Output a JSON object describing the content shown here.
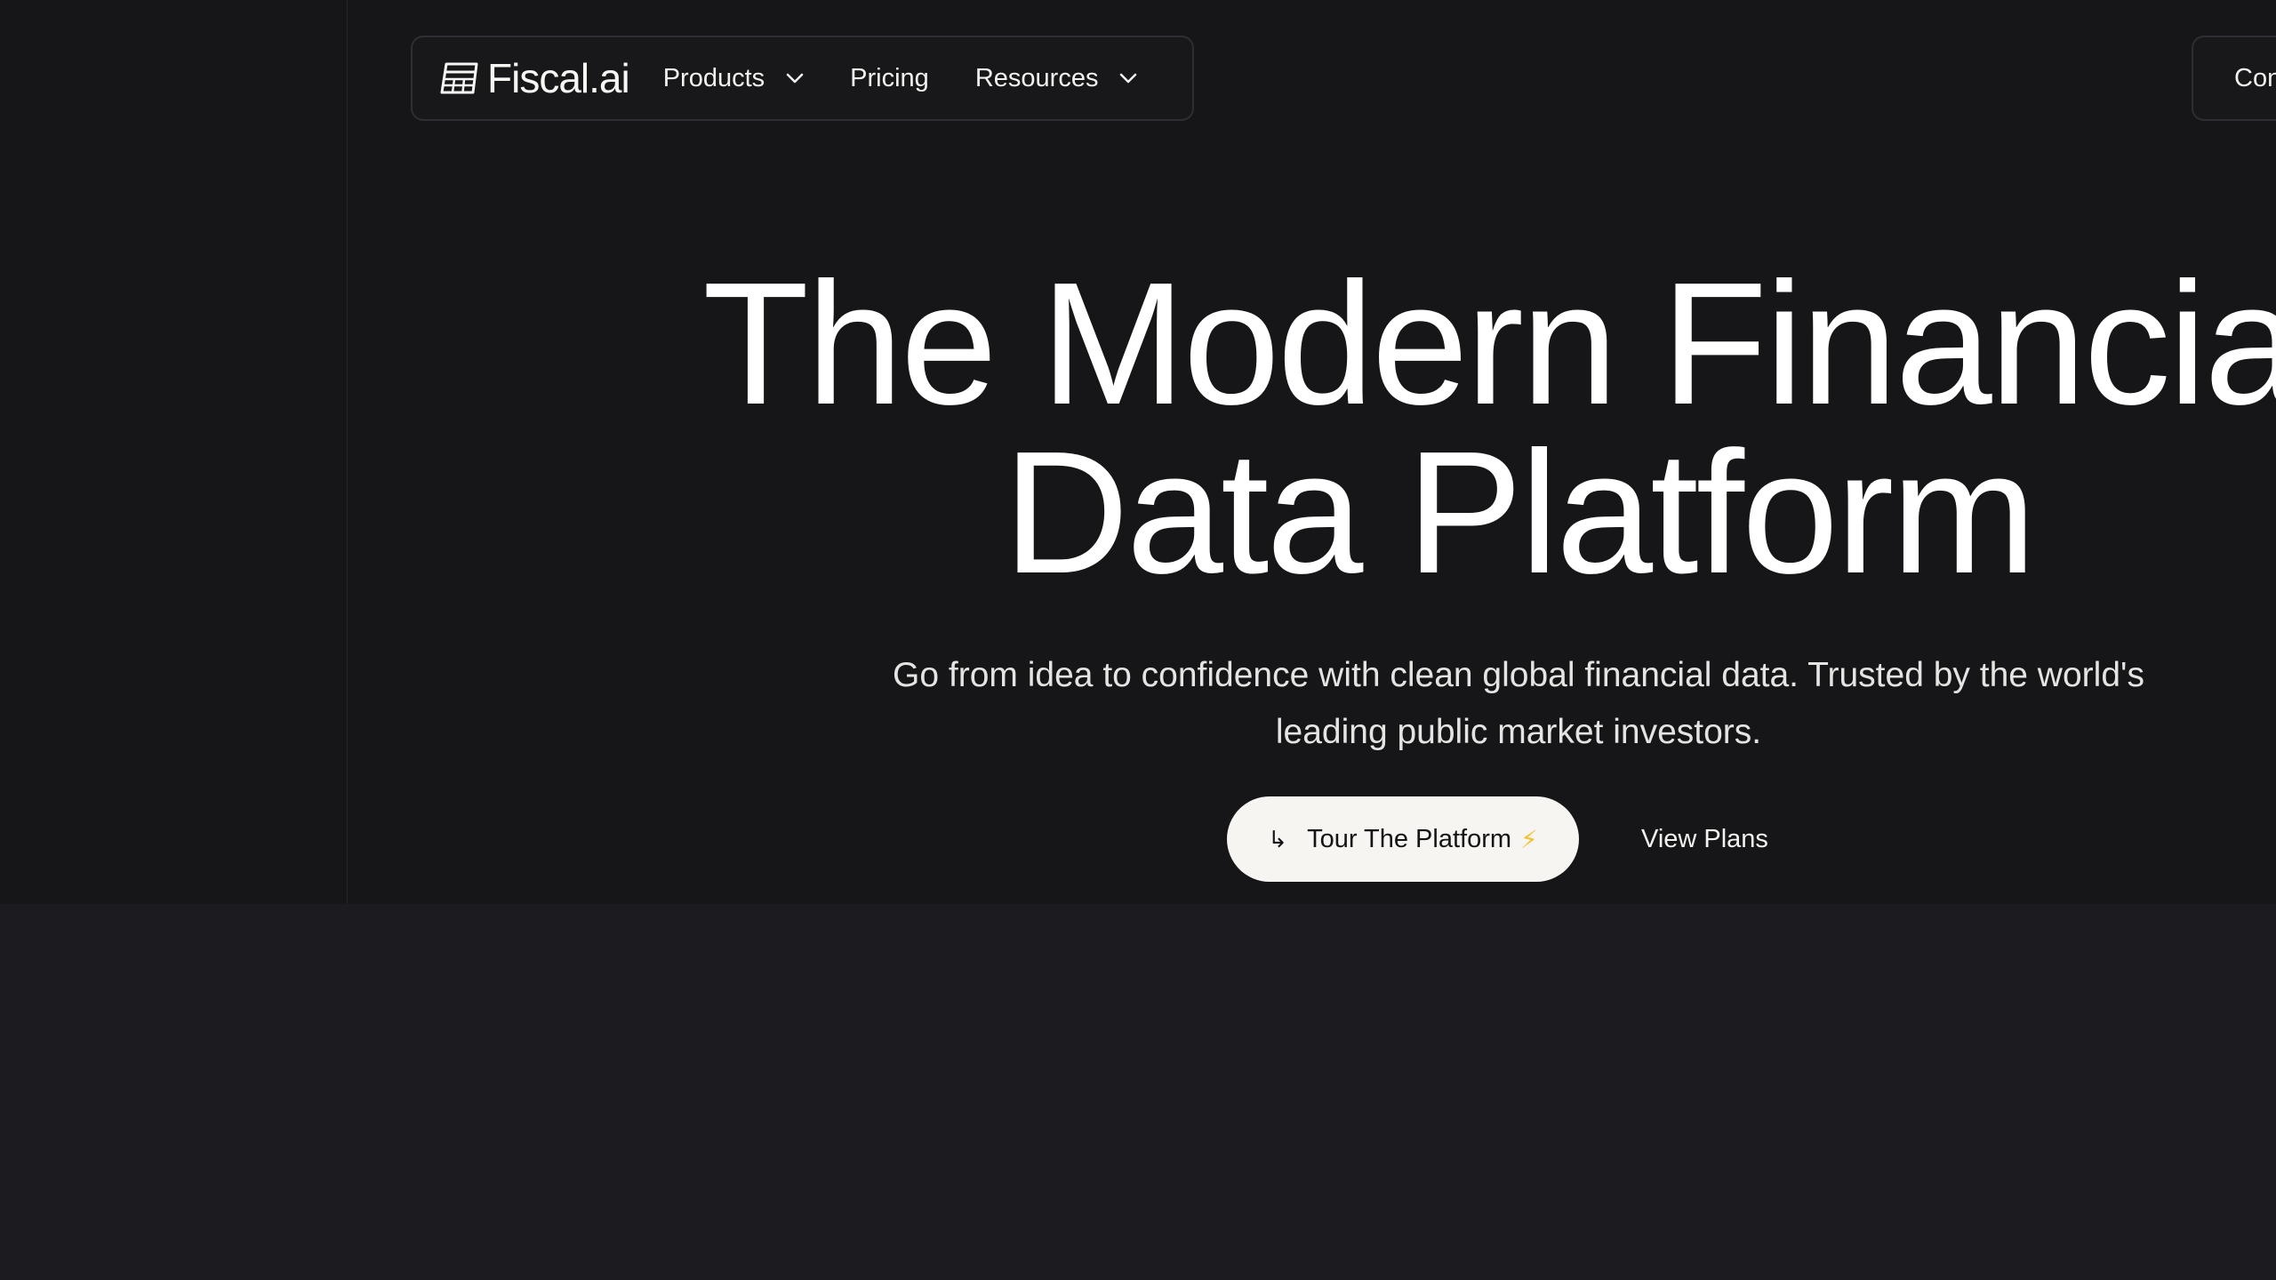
{
  "nav": {
    "brand": "Fiscal.ai",
    "logo_icon": "ledger-grid-icon",
    "items": [
      {
        "label": "Products",
        "has_dropdown": true
      },
      {
        "label": "Pricing",
        "has_dropdown": false
      },
      {
        "label": "Resources",
        "has_dropdown": true
      }
    ],
    "right_button_label": "Con"
  },
  "hero": {
    "headline_line1": "The Modern Financial",
    "headline_line2": "Data Platform",
    "subtitle": "Go from idea to confidence with clean global financial data. Trusted by the world's leading public market investors.",
    "primary_cta": {
      "arrow": "↳",
      "label": "Tour The Platform",
      "emoji": "⚡"
    },
    "secondary_cta": "View Plans"
  },
  "colors": {
    "hero_bg": "#161619",
    "lower_bg": "#1b1b20",
    "primary_button_bg": "#f6f5f1",
    "bolt": "#f1c232"
  }
}
